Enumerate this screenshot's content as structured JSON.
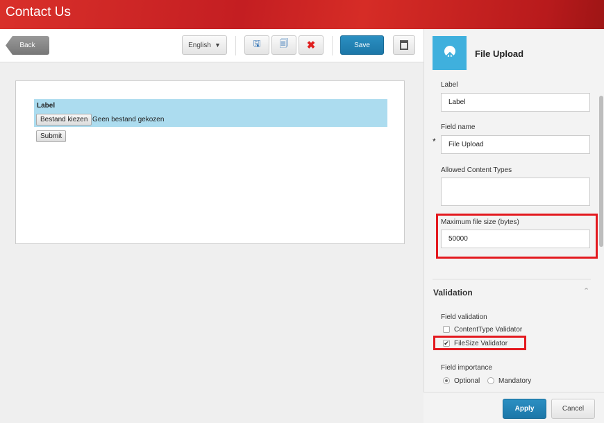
{
  "header": {
    "title": "Contact Us"
  },
  "toolbar": {
    "back": "Back",
    "language": "English",
    "save": "Save"
  },
  "form_preview": {
    "label": "Label",
    "choose_file": "Bestand kiezen",
    "no_file": "Geen bestand gekozen",
    "submit": "Submit"
  },
  "panel": {
    "title": "File Upload",
    "label_caption": "Label",
    "label_value": "Label",
    "field_name_caption": "Field name",
    "field_name_value": "File Upload",
    "required_mark": "*",
    "content_types_caption": "Allowed Content Types",
    "content_types_value": "",
    "max_size_caption": "Maximum file size (bytes)",
    "max_size_value": "50000",
    "validation_heading": "Validation",
    "field_validation": "Field validation",
    "validators": [
      {
        "label": "ContentType Validator",
        "checked": false
      },
      {
        "label": "FileSize Validator",
        "checked": true
      }
    ],
    "field_importance": "Field importance",
    "importance_options": [
      {
        "label": "Optional",
        "selected": true
      },
      {
        "label": "Mandatory",
        "selected": false
      }
    ],
    "apply": "Apply",
    "cancel": "Cancel"
  },
  "colors": {
    "brand": "#c41e22",
    "accent": "#2b8fc2",
    "highlight": "#e3191f"
  }
}
